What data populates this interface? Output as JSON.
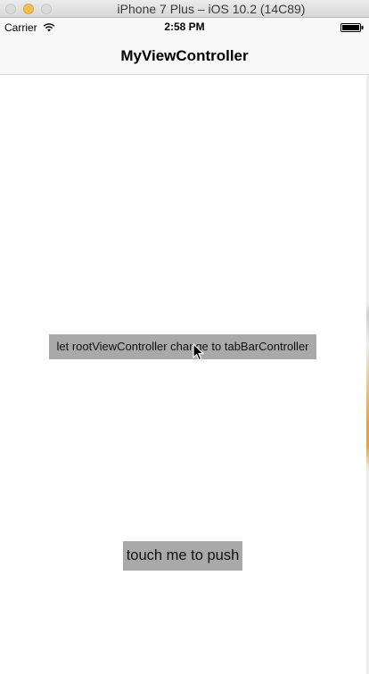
{
  "window": {
    "title": "iPhone 7 Plus – iOS 10.2 (14C89)"
  },
  "status_bar": {
    "carrier": "Carrier",
    "time": "2:58 PM",
    "icons": [
      "wifi-icon",
      "battery-icon"
    ]
  },
  "nav_bar": {
    "title": "MyViewController"
  },
  "main": {
    "root_button_label": "let rootViewController change to tabBarController",
    "push_button_label": "touch me to push"
  },
  "colors": {
    "button_background": "#a9a9a9",
    "nav_background": "#f8f8f8",
    "minimize_yellow": "#f5bf4f"
  }
}
